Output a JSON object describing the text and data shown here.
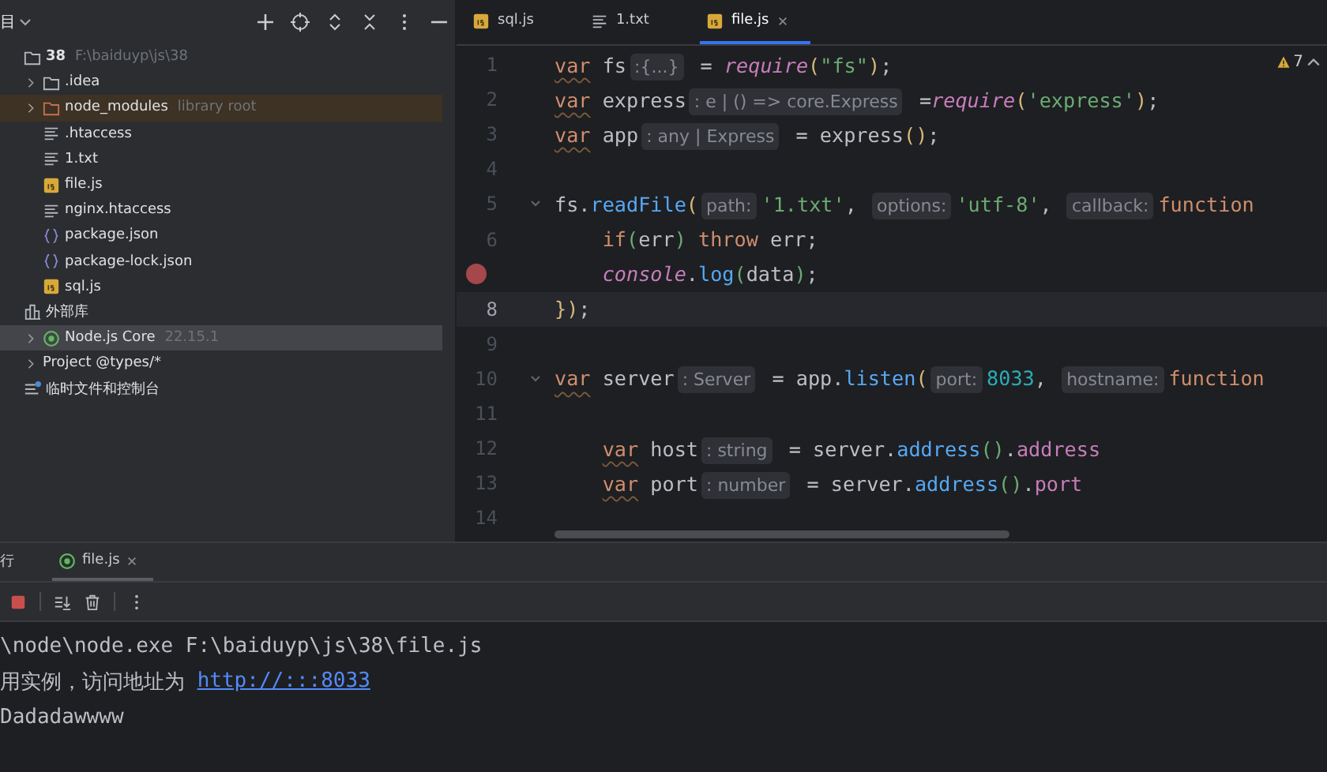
{
  "sidebar": {
    "title": "目",
    "tree": [
      {
        "kind": "folder",
        "name": "38",
        "hint": "F:\\baiduyp\\js\\38",
        "children": [
          {
            "kind": "folder",
            "name": ".idea",
            "expanded": false
          },
          {
            "kind": "excluded-folder",
            "name": "node_modules",
            "hint": "library root",
            "expanded": false
          },
          {
            "kind": "text",
            "name": ".htaccess"
          },
          {
            "kind": "text",
            "name": "1.txt"
          },
          {
            "kind": "js",
            "name": "file.js"
          },
          {
            "kind": "text",
            "name": "nginx.htaccess"
          },
          {
            "kind": "json",
            "name": "package.json"
          },
          {
            "kind": "json",
            "name": "package-lock.json"
          },
          {
            "kind": "js",
            "name": "sql.js"
          }
        ]
      },
      {
        "kind": "library",
        "name": "外部库",
        "children": [
          {
            "kind": "node",
            "name": "Node.js Core",
            "hint": "22.15.1",
            "expanded": false,
            "selected": true
          },
          {
            "kind": "plain",
            "name": "Project @types/*",
            "expanded": false,
            "selected": false
          }
        ]
      },
      {
        "kind": "scratch",
        "name": "临时文件和控制台"
      }
    ]
  },
  "editor": {
    "tabs": [
      {
        "kind": "js",
        "label": "sql.js",
        "selected": false
      },
      {
        "kind": "text",
        "label": "1.txt",
        "selected": false
      },
      {
        "kind": "js",
        "label": "file.js",
        "selected": true
      }
    ],
    "warnings": "7",
    "lines": [
      {
        "number": "1",
        "tokens": [
          {
            "kind": "kw",
            "text": "var"
          },
          {
            "kind": "id",
            "text": " fs"
          },
          {
            "kind": "hint",
            "text": ":{...}"
          },
          {
            "kind": "id",
            "text": " = "
          },
          {
            "kind": "call",
            "text": "require"
          },
          {
            "kind": "br",
            "text": "("
          },
          {
            "kind": "str",
            "text": "\"fs\""
          },
          {
            "kind": "br",
            "text": ")"
          },
          {
            "kind": "id",
            "text": ";"
          }
        ]
      },
      {
        "number": "2",
        "tokens": [
          {
            "kind": "kw",
            "text": "var"
          },
          {
            "kind": "id",
            "text": " express"
          },
          {
            "kind": "hint",
            "text": ": e | () => core.Express"
          },
          {
            "kind": "id",
            "text": " ="
          },
          {
            "kind": "call",
            "text": "require"
          },
          {
            "kind": "br",
            "text": "("
          },
          {
            "kind": "str",
            "text": "'express'"
          },
          {
            "kind": "br",
            "text": ")"
          },
          {
            "kind": "id",
            "text": ";"
          }
        ]
      },
      {
        "number": "3",
        "tokens": [
          {
            "kind": "kw",
            "text": "var"
          },
          {
            "kind": "id",
            "text": " app"
          },
          {
            "kind": "hint",
            "text": ": any | Express"
          },
          {
            "kind": "id",
            "text": " = express"
          },
          {
            "kind": "br",
            "text": "()"
          },
          {
            "kind": "id",
            "text": ";"
          }
        ]
      },
      {
        "number": "4"
      },
      {
        "number": "5",
        "fold": true,
        "tokens": [
          {
            "kind": "id",
            "text": "fs."
          },
          {
            "kind": "fn",
            "text": "readFile"
          },
          {
            "kind": "br",
            "text": "("
          },
          {
            "kind": "hint",
            "text": "path:"
          },
          {
            "kind": "str",
            "text": "'1.txt'"
          },
          {
            "kind": "id",
            "text": ", "
          },
          {
            "kind": "hint",
            "text": "options:"
          },
          {
            "kind": "str",
            "text": "'utf-8'"
          },
          {
            "kind": "id",
            "text": ", "
          },
          {
            "kind": "hint",
            "text": "callback:"
          },
          {
            "kind": "kw2",
            "text": "function"
          }
        ]
      },
      {
        "number": "6",
        "indented": true,
        "tokens": [
          {
            "kind": "kw2",
            "text": "if"
          },
          {
            "kind": "br2",
            "text": "("
          },
          {
            "kind": "id",
            "text": "err"
          },
          {
            "kind": "br2",
            "text": ")"
          },
          {
            "kind": "kw2",
            "text": " throw"
          },
          {
            "kind": "id",
            "text": " err;"
          }
        ]
      },
      {
        "breakpoint": true,
        "indented": true,
        "tokens": [
          {
            "kind": "call",
            "text": "console"
          },
          {
            "kind": "id",
            "text": "."
          },
          {
            "kind": "fn",
            "text": "log"
          },
          {
            "kind": "br2",
            "text": "("
          },
          {
            "kind": "id",
            "text": "data"
          },
          {
            "kind": "br2",
            "text": ")"
          },
          {
            "kind": "id",
            "text": ";"
          }
        ]
      },
      {
        "number": "8",
        "current": true,
        "tokens": [
          {
            "kind": "br",
            "text": "})"
          },
          {
            "kind": "id",
            "text": ";"
          }
        ]
      },
      {
        "number": "9"
      },
      {
        "number": "10",
        "fold": true,
        "tokens": [
          {
            "kind": "kw",
            "text": "var"
          },
          {
            "kind": "id",
            "text": " server"
          },
          {
            "kind": "hint",
            "text": ": Server"
          },
          {
            "kind": "id",
            "text": " = app."
          },
          {
            "kind": "fn",
            "text": "listen"
          },
          {
            "kind": "br",
            "text": "("
          },
          {
            "kind": "hint",
            "text": "port:"
          },
          {
            "kind": "num",
            "text": "8033"
          },
          {
            "kind": "id",
            "text": ", "
          },
          {
            "kind": "hint",
            "text": "hostname:"
          },
          {
            "kind": "kw2",
            "text": "function"
          }
        ]
      },
      {
        "number": "11"
      },
      {
        "number": "12",
        "indented": true,
        "tokens": [
          {
            "kind": "kw",
            "text": "var"
          },
          {
            "kind": "id",
            "text": " host"
          },
          {
            "kind": "hint",
            "text": ": string"
          },
          {
            "kind": "id",
            "text": " = server."
          },
          {
            "kind": "fn",
            "text": "address"
          },
          {
            "kind": "br2",
            "text": "()"
          },
          {
            "kind": "id",
            "text": "."
          },
          {
            "kind": "prop",
            "text": "address"
          }
        ]
      },
      {
        "number": "13",
        "indented": true,
        "tokens": [
          {
            "kind": "kw",
            "text": "var"
          },
          {
            "kind": "id",
            "text": " port"
          },
          {
            "kind": "hint",
            "text": ": number"
          },
          {
            "kind": "id",
            "text": " = server."
          },
          {
            "kind": "fn",
            "text": "address"
          },
          {
            "kind": "br2",
            "text": "()"
          },
          {
            "kind": "id",
            "text": "."
          },
          {
            "kind": "prop",
            "text": "port"
          }
        ]
      },
      {
        "number": "14"
      }
    ]
  },
  "run_panel": {
    "tabs": [
      {
        "label": "行",
        "selected": false,
        "closable": false
      },
      {
        "label": "file.js",
        "selected": true,
        "closable": true
      }
    ],
    "console": [
      {
        "text": "\\node\\node.exe F:\\baiduyp\\js\\38\\file.js"
      },
      {
        "text": "用实例，访问地址为 ",
        "link": "http://:::8033"
      },
      {
        "text": "Dadadawwww"
      }
    ]
  }
}
